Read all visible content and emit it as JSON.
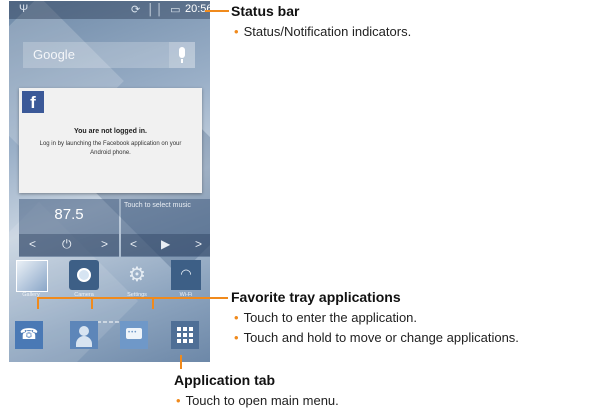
{
  "phone": {
    "status_bar": {
      "usb_glyph": "Ψ",
      "indicators": "⟳ ││ ▭",
      "time": "20:56"
    },
    "search": {
      "label": "Google"
    },
    "facebook_widget": {
      "logo": "f",
      "title": "You are not logged in.",
      "message": "Log in by launching the Facebook application on your Android phone."
    },
    "radio_widget": {
      "frequency": "87.5",
      "prev": "<",
      "power": "⏻",
      "next": ">"
    },
    "music_widget": {
      "prompt": "Touch to select music",
      "prev": "<",
      "play": "▶",
      "next": ">"
    },
    "shortcuts": [
      {
        "label": "Gallery",
        "icon": "gallery-icon"
      },
      {
        "label": "Camera",
        "icon": "camera-icon"
      },
      {
        "label": "Settings",
        "icon": "settings-icon"
      },
      {
        "label": "Wi-Fi",
        "icon": "wifi-icon"
      }
    ],
    "settings_glyph": "⚙",
    "wifi_glyph": "◠",
    "phone_glyph": "☎",
    "message_glyph": "•••",
    "page_indicator": {
      "total": 5,
      "active": 1
    },
    "favorites": [
      "phone-icon",
      "contacts-icon",
      "messages-icon"
    ],
    "app_tab_icon": "app-grid-icon"
  },
  "callouts": {
    "bullet": "•",
    "status_bar": {
      "title": "Status bar",
      "items": [
        "Status/Notification indicators."
      ]
    },
    "favorite_tray": {
      "title": "Favorite tray applications",
      "items": [
        "Touch to enter the application.",
        "Touch and hold to move or change applications."
      ]
    },
    "application_tab": {
      "title": "Application tab",
      "items": [
        "Touch to open main menu."
      ]
    }
  },
  "colors": {
    "callout": "#f08a1c",
    "facebook": "#3b5998",
    "text": "#111111"
  }
}
